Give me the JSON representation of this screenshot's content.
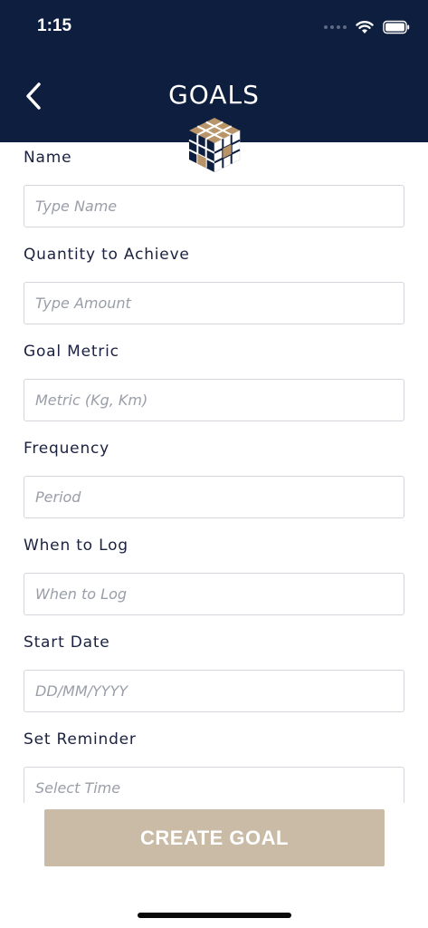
{
  "status_bar": {
    "time": "1:15"
  },
  "header": {
    "title": "GOALS"
  },
  "form": {
    "fields": [
      {
        "label": "Name",
        "placeholder": "Type Name"
      },
      {
        "label": "Quantity to Achieve",
        "placeholder": "Type Amount"
      },
      {
        "label": "Goal Metric",
        "placeholder": "Metric (Kg, Km)"
      },
      {
        "label": "Frequency",
        "placeholder": "Period"
      },
      {
        "label": "When to Log",
        "placeholder": "When to Log"
      },
      {
        "label": "Start Date",
        "placeholder": "DD/MM/YYYY"
      },
      {
        "label": "Set Reminder",
        "placeholder": "Select Time"
      }
    ]
  },
  "actions": {
    "create_label": "CREATE GOAL"
  },
  "colors": {
    "header_bg": "#0e1e3e",
    "button_bg": "#c9bba5",
    "accent_gold": "#b89468"
  }
}
